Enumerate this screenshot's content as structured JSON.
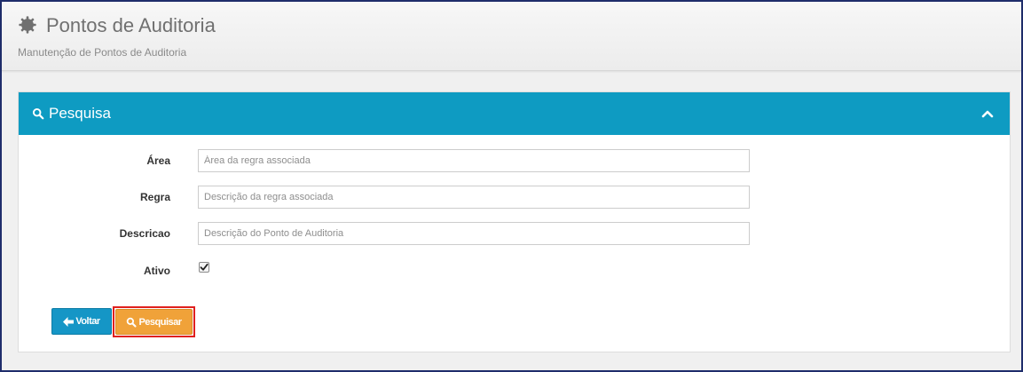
{
  "header": {
    "title": "Pontos de Auditoria",
    "subtitle": "Manutenção de Pontos de Auditoria",
    "icon": "gear-icon"
  },
  "panel": {
    "title": "Pesquisa",
    "icon": "search-icon",
    "collapse_icon": "chevron-up-icon",
    "accent_color": "#0e9bc2"
  },
  "form": {
    "area": {
      "label": "Área",
      "value": "",
      "placeholder": "Área da regra associada"
    },
    "regra": {
      "label": "Regra",
      "value": "",
      "placeholder": "Descrição da regra associada"
    },
    "descricao": {
      "label": "Descricao",
      "value": "",
      "placeholder": "Descrição do Ponto de Auditoria"
    },
    "ativo": {
      "label": "Ativo",
      "checked": true
    }
  },
  "buttons": {
    "back": {
      "label": "Voltar",
      "icon": "arrow-left-icon",
      "color": "#1596c6"
    },
    "search": {
      "label": "Pesquisar",
      "icon": "search-icon",
      "color": "#f0a239",
      "highlight_color": "#e0201e"
    }
  }
}
